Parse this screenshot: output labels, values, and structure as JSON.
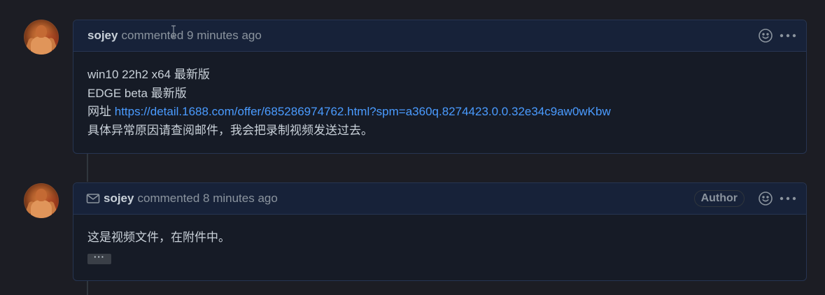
{
  "comments": [
    {
      "author": "sojey",
      "meta": "commented 9 minutes ago",
      "show_mail_icon": false,
      "badge": "",
      "body_lines": [
        "win10 22h2 x64 最新版",
        "EDGE beta 最新版"
      ],
      "url_prefix": "网址 ",
      "url": "https://detail.1688.com/offer/685286974762.html?spm=a360q.8274423.0.0.32e34c9aw0wKbw",
      "body_after": "具体异常原因请查阅邮件，我会把录制视频发送过去。"
    },
    {
      "author": "sojey",
      "meta": "commented 8 minutes ago",
      "show_mail_icon": true,
      "badge": "Author",
      "body_text": "这是视频文件，在附件中。",
      "ellipsis": "···"
    }
  ],
  "icons": {
    "reaction": "smiley-icon",
    "more": "kebab-horizontal-icon",
    "mail": "mail-icon"
  },
  "colors": {
    "background": "#1c1d24",
    "header_bg": "#172239",
    "border": "#273552",
    "link": "#4a9bff",
    "muted": "#8b949e"
  }
}
